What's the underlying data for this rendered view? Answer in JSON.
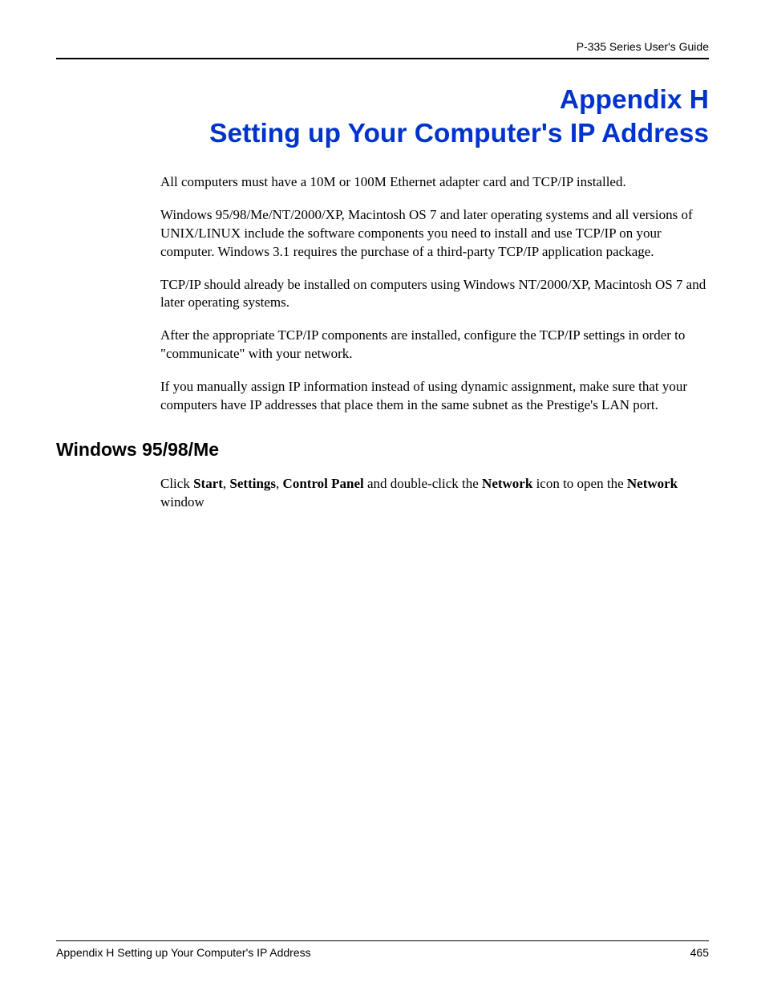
{
  "header": {
    "guide_title": "P-335 Series User's Guide"
  },
  "title": {
    "label": "Appendix H",
    "text": "Setting up Your Computer's IP Address"
  },
  "paragraphs": {
    "p1": "All computers must have a 10M or 100M Ethernet adapter card and TCP/IP installed.",
    "p2": "Windows 95/98/Me/NT/2000/XP, Macintosh OS 7 and later operating systems and all versions of UNIX/LINUX include the software components you need to install and use TCP/IP on your computer. Windows 3.1 requires the purchase of a third-party TCP/IP application package.",
    "p3": "TCP/IP should already be installed on computers using Windows NT/2000/XP, Macintosh OS 7 and later operating systems.",
    "p4": "After the appropriate TCP/IP components are installed, configure the TCP/IP settings in order to \"communicate\" with your network.",
    "p5": "If you manually assign IP information instead of using dynamic assignment, make sure that your computers have IP addresses that place them in the same subnet as the Prestige's LAN port."
  },
  "section": {
    "heading": "Windows 95/98/Me",
    "instr": {
      "pre": "Click ",
      "b1": "Start",
      "sep1": ", ",
      "b2": "Settings",
      "sep2": ", ",
      "b3": "Control Panel",
      "mid": " and double-click the ",
      "b4": "Network",
      "mid2": " icon to open the ",
      "b5": "Network",
      "post": " window"
    }
  },
  "footer": {
    "text": "Appendix H Setting up Your Computer's IP Address",
    "page": "465"
  }
}
